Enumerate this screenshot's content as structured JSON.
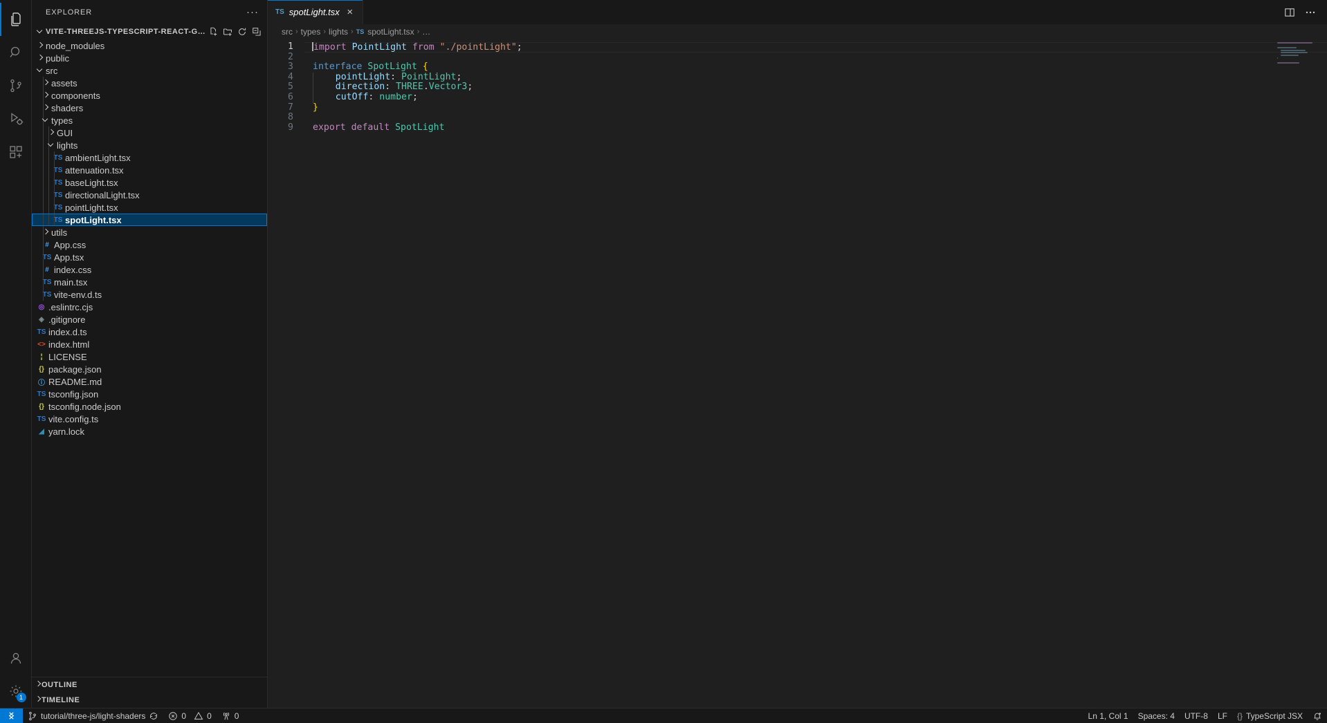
{
  "activitybar": {
    "items": [
      {
        "name": "explorer",
        "icon": "files-icon",
        "active": true
      },
      {
        "name": "search",
        "icon": "search-icon",
        "active": false
      },
      {
        "name": "source-control",
        "icon": "source-control-icon",
        "active": false
      },
      {
        "name": "run-and-debug",
        "icon": "run-debug-icon",
        "active": false
      },
      {
        "name": "extensions",
        "icon": "extensions-icon",
        "active": false
      }
    ],
    "bottom": [
      {
        "name": "accounts",
        "icon": "account-icon",
        "badge": ""
      },
      {
        "name": "manage",
        "icon": "gear-icon",
        "badge": "1"
      }
    ]
  },
  "sidebar": {
    "title": "EXPLORER",
    "more_label": "···",
    "root_folder": "VITE-THREEJS-TYPESCRIPT-REACT-GLSL-STARTER-…",
    "actions": [
      "new-file-icon",
      "new-folder-icon",
      "refresh-icon",
      "collapse-all-icon"
    ],
    "tree": [
      {
        "label": "node_modules",
        "depth": 1,
        "kind": "folder",
        "expanded": false,
        "icon": "",
        "color": ""
      },
      {
        "label": "public",
        "depth": 1,
        "kind": "folder",
        "expanded": false,
        "icon": "",
        "color": ""
      },
      {
        "label": "src",
        "depth": 1,
        "kind": "folder",
        "expanded": true,
        "icon": "",
        "color": ""
      },
      {
        "label": "assets",
        "depth": 2,
        "kind": "folder",
        "expanded": false,
        "icon": "",
        "color": ""
      },
      {
        "label": "components",
        "depth": 2,
        "kind": "folder",
        "expanded": false,
        "icon": "",
        "color": ""
      },
      {
        "label": "shaders",
        "depth": 2,
        "kind": "folder",
        "expanded": false,
        "icon": "",
        "color": ""
      },
      {
        "label": "types",
        "depth": 2,
        "kind": "folder",
        "expanded": true,
        "icon": "",
        "color": ""
      },
      {
        "label": "GUI",
        "depth": 3,
        "kind": "folder",
        "expanded": false,
        "icon": "",
        "color": ""
      },
      {
        "label": "lights",
        "depth": 3,
        "kind": "folder",
        "expanded": true,
        "icon": "",
        "color": ""
      },
      {
        "label": "ambientLight.tsx",
        "depth": 4,
        "kind": "file",
        "icon": "TS",
        "color": "#3178c6"
      },
      {
        "label": "attenuation.tsx",
        "depth": 4,
        "kind": "file",
        "icon": "TS",
        "color": "#3178c6"
      },
      {
        "label": "baseLight.tsx",
        "depth": 4,
        "kind": "file",
        "icon": "TS",
        "color": "#3178c6"
      },
      {
        "label": "directionalLight.tsx",
        "depth": 4,
        "kind": "file",
        "icon": "TS",
        "color": "#3178c6"
      },
      {
        "label": "pointLight.tsx",
        "depth": 4,
        "kind": "file",
        "icon": "TS",
        "color": "#3178c6"
      },
      {
        "label": "spotLight.tsx",
        "depth": 4,
        "kind": "file",
        "icon": "TS",
        "color": "#3178c6",
        "selected": true
      },
      {
        "label": "utils",
        "depth": 2,
        "kind": "folder",
        "expanded": false,
        "icon": "",
        "color": ""
      },
      {
        "label": "App.css",
        "depth": 2,
        "kind": "file",
        "icon": "#",
        "color": "#42a5f5"
      },
      {
        "label": "App.tsx",
        "depth": 2,
        "kind": "file",
        "icon": "TS",
        "color": "#3178c6"
      },
      {
        "label": "index.css",
        "depth": 2,
        "kind": "file",
        "icon": "#",
        "color": "#42a5f5"
      },
      {
        "label": "main.tsx",
        "depth": 2,
        "kind": "file",
        "icon": "TS",
        "color": "#3178c6"
      },
      {
        "label": "vite-env.d.ts",
        "depth": 2,
        "kind": "file",
        "icon": "TS",
        "color": "#3178c6"
      },
      {
        "label": ".eslintrc.cjs",
        "depth": 1,
        "kind": "file",
        "icon": "◎",
        "color": "#a855f7"
      },
      {
        "label": ".gitignore",
        "depth": 1,
        "kind": "file",
        "icon": "◈",
        "color": "#7a8b8b"
      },
      {
        "label": "index.d.ts",
        "depth": 1,
        "kind": "file",
        "icon": "TS",
        "color": "#3178c6"
      },
      {
        "label": "index.html",
        "depth": 1,
        "kind": "file",
        "icon": "<>",
        "color": "#e44d26"
      },
      {
        "label": "LICENSE",
        "depth": 1,
        "kind": "file",
        "icon": "¦",
        "color": "#cddc39"
      },
      {
        "label": "package.json",
        "depth": 1,
        "kind": "file",
        "icon": "{}",
        "color": "#cbcb41"
      },
      {
        "label": "README.md",
        "depth": 1,
        "kind": "file",
        "icon": "ⓘ",
        "color": "#42a5f5"
      },
      {
        "label": "tsconfig.json",
        "depth": 1,
        "kind": "file",
        "icon": "TS",
        "color": "#3178c6"
      },
      {
        "label": "tsconfig.node.json",
        "depth": 1,
        "kind": "file",
        "icon": "{}",
        "color": "#cbcb41"
      },
      {
        "label": "vite.config.ts",
        "depth": 1,
        "kind": "file",
        "icon": "TS",
        "color": "#3178c6"
      },
      {
        "label": "yarn.lock",
        "depth": 1,
        "kind": "file",
        "icon": "◢",
        "color": "#2c8ebb"
      }
    ],
    "panels": [
      {
        "label": "OUTLINE"
      },
      {
        "label": "TIMELINE"
      }
    ]
  },
  "editor": {
    "tab": {
      "icon": "TS",
      "title": "spotLight.tsx",
      "close": "×"
    },
    "tab_actions": [
      "split-editor-icon",
      "more-actions-icon"
    ],
    "breadcrumbs": [
      "src",
      "types",
      "lights",
      "spotLight.tsx",
      "…"
    ],
    "breadcrumb_file_icon": "TS",
    "lines": [
      {
        "n": "1",
        "tokens": [
          {
            "t": "import ",
            "c": "t-key"
          },
          {
            "t": "PointLight",
            "c": "t-var"
          },
          {
            "t": " from ",
            "c": "t-key"
          },
          {
            "t": "\"./pointLight\"",
            "c": "t-str"
          },
          {
            "t": ";",
            "c": "t-punc"
          }
        ]
      },
      {
        "n": "2",
        "tokens": []
      },
      {
        "n": "3",
        "tokens": [
          {
            "t": "interface",
            "c": "t-key2"
          },
          {
            "t": " ",
            "c": "t-plain"
          },
          {
            "t": "SpotLight",
            "c": "t-type"
          },
          {
            "t": " ",
            "c": "t-plain"
          },
          {
            "t": "{",
            "c": "t-brace2"
          }
        ]
      },
      {
        "n": "4",
        "indent": 1,
        "tokens": [
          {
            "t": "    pointLight",
            "c": "t-var"
          },
          {
            "t": ": ",
            "c": "t-punc"
          },
          {
            "t": "PointLight",
            "c": "t-type"
          },
          {
            "t": ";",
            "c": "t-punc"
          }
        ]
      },
      {
        "n": "5",
        "indent": 1,
        "tokens": [
          {
            "t": "    direction",
            "c": "t-var"
          },
          {
            "t": ": ",
            "c": "t-punc"
          },
          {
            "t": "THREE",
            "c": "t-type"
          },
          {
            "t": ".",
            "c": "t-punc"
          },
          {
            "t": "Vector3",
            "c": "t-type"
          },
          {
            "t": ";",
            "c": "t-punc"
          }
        ]
      },
      {
        "n": "6",
        "indent": 1,
        "tokens": [
          {
            "t": "    cutOff",
            "c": "t-var"
          },
          {
            "t": ": ",
            "c": "t-punc"
          },
          {
            "t": "number",
            "c": "t-type"
          },
          {
            "t": ";",
            "c": "t-punc"
          }
        ]
      },
      {
        "n": "7",
        "tokens": [
          {
            "t": "}",
            "c": "t-brace2"
          }
        ]
      },
      {
        "n": "8",
        "tokens": []
      },
      {
        "n": "9",
        "tokens": [
          {
            "t": "export ",
            "c": "t-key"
          },
          {
            "t": "default",
            "c": "t-key"
          },
          {
            "t": " ",
            "c": "t-plain"
          },
          {
            "t": "SpotLight",
            "c": "t-type"
          }
        ]
      }
    ]
  },
  "statusbar": {
    "remote_icon": "remote-window-icon",
    "branch_icon": "source-control-branch-icon",
    "branch": "tutorial/three-js/light-shaders",
    "sync_icon": "sync-icon",
    "errors_icon": "error-icon",
    "errors": "0",
    "warnings_icon": "warning-icon",
    "warnings": "0",
    "ports_icon": "radio-tower-icon",
    "ports": "0",
    "cursor_position": "Ln 1, Col 1",
    "indentation": "Spaces: 4",
    "encoding": "UTF-8",
    "eol": "LF",
    "language_icon": "{}",
    "language": "TypeScript JSX",
    "bell_icon": "bell-dot-icon"
  },
  "colors": {
    "accent": "#0078d4",
    "selection_bg": "#04395e",
    "editor_bg": "#1f1f1f",
    "chrome_bg": "#181818"
  }
}
